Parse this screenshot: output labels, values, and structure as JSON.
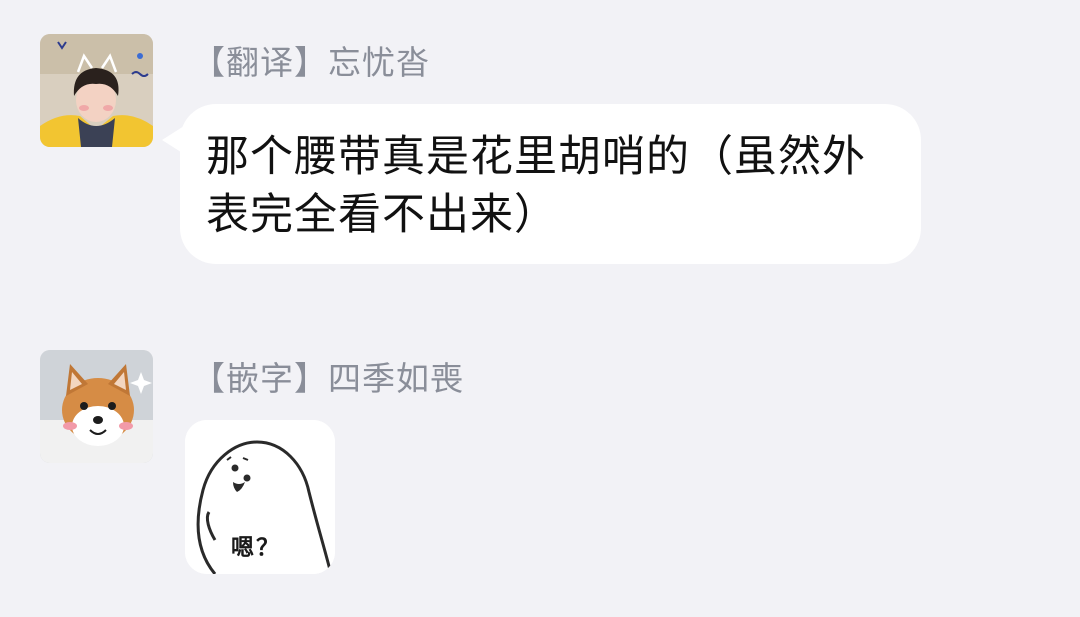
{
  "messages": [
    {
      "sender": "【翻译】忘忧沓",
      "avatar": "avatar-boy-with-cat-ears",
      "text": "那个腰带真是花里胡哨的（虽然外表完全看不出来）"
    },
    {
      "sender": "【嵌字】四季如喪",
      "avatar": "avatar-shiba-dog",
      "sticker": {
        "icon": "ghost-sticker",
        "caption": "嗯？"
      }
    }
  ],
  "colors": {
    "background": "#f2f2f6",
    "bubble": "#ffffff",
    "sender_text": "#8a8e99",
    "message_text": "#111111"
  }
}
